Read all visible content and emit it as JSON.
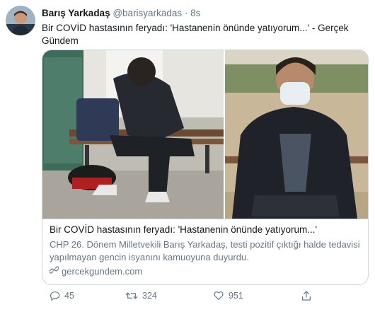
{
  "tweet": {
    "author_name": "Barış Yarkadaş",
    "author_handle": "@barisyarkadas",
    "separator": "·",
    "time": "8s",
    "text": "Bir COVİD hastasının feryadı: 'Hastanenin önünde yatıyorum...' - Gerçek Gündem"
  },
  "card": {
    "title": "Bir COVİD hastasının feryadı: 'Hastanenin önünde yatıyorum...'",
    "description": "CHP 26. Dönem Milletvekili Barış Yarkadaş, testi pozitif çıktığı halde tedavisi yapılmayan gencin isyanını kamuoyuna duyurdu.",
    "link": "gercekgundem.com"
  },
  "actions": {
    "reply_count": "45",
    "retweet_count": "324",
    "like_count": "951"
  },
  "colors": {
    "secondary_text": "#657786",
    "border": "#ccd6dd"
  }
}
